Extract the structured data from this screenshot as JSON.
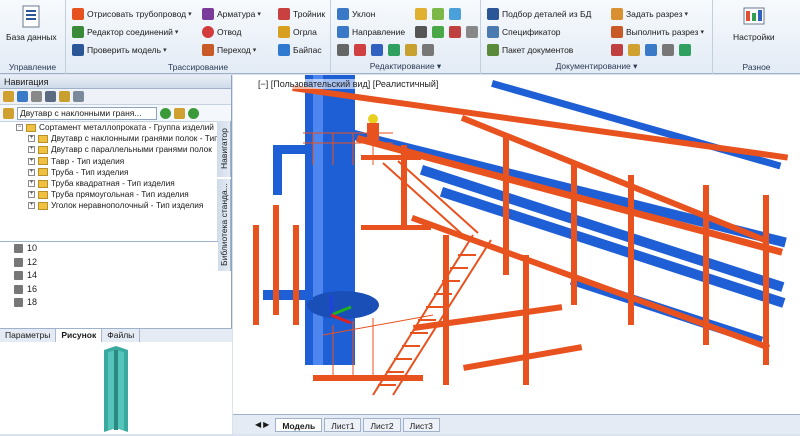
{
  "ribbon": {
    "groups": [
      {
        "name": "Управление"
      },
      {
        "name": "Трассирование"
      },
      {
        "name": "Редактирование"
      },
      {
        "name": "Документирование"
      },
      {
        "name": "Разное"
      }
    ],
    "db_label": "База данных",
    "settings_label": "Настройки",
    "trace": {
      "draw_pipe": "Отрисовать трубопровод",
      "armatura": "Арматура",
      "tee": "Тройник",
      "conn_editor": "Редактор соединений",
      "otvod": "Отвод",
      "ograda": "Огрла",
      "check_model": "Проверить модель",
      "perehod": "Переход",
      "bypass": "Байпас"
    },
    "edit": {
      "slope": "Уклон",
      "direction": "Направление"
    },
    "doc": {
      "select_parts": "Подбор деталей из БД",
      "set_section": "Задать разрез",
      "specifier": "Спецификатор",
      "run_section": "Выполнить разрез",
      "doc_package": "Пакет документов"
    }
  },
  "nav": {
    "title": "Навигация",
    "combo_value": "Двутавр с наклонными граня...",
    "tree": [
      "Сортамент металлопроката - Группа изделий",
      "Двутавр с наклонными гранями полок - Тип",
      "Двутавр с параллельными гранями полок",
      "Тавр - Тип изделия",
      "Труба - Тип изделия",
      "Труба квадратная - Тип изделия",
      "Труба прямоугольная - Тип изделия",
      "Уголок неравнополочный - Тип изделия"
    ],
    "list": [
      "10",
      "12",
      "14",
      "16",
      "18"
    ],
    "vtab_navigator": "Навигатор",
    "vtab_library": "Библиотека станда...",
    "tabs": [
      "Параметры",
      "Рисунок",
      "Файлы"
    ]
  },
  "viewport": {
    "label": "[−] [Пользовательский вид] [Реалистичный]"
  },
  "sheet_tabs": [
    "Модель",
    "Лист1",
    "Лист2",
    "Лист3"
  ],
  "colors": {
    "steel": "#e8521f",
    "pipe": "#1f5fd6",
    "accent": "#2b5797"
  }
}
